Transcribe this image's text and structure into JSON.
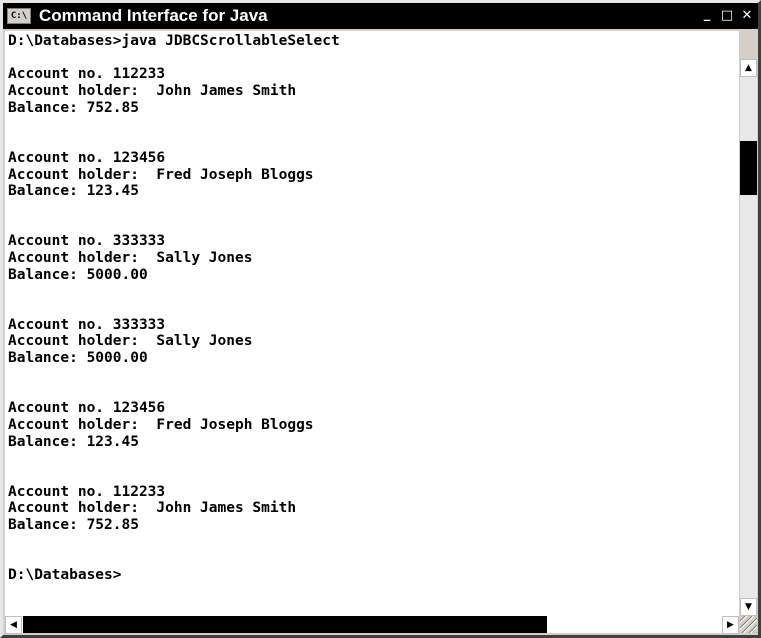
{
  "window": {
    "title": "Command Interface for Java",
    "icon_label": "C:\\",
    "icon": "console-icon",
    "buttons": {
      "minimize": "_",
      "maximize": "□",
      "close": "✕"
    }
  },
  "console": {
    "lines": [
      "D:\\Databases>java JDBCScrollableSelect",
      "",
      "Account no. 112233",
      "Account holder:  John James Smith",
      "Balance: 752.85",
      "",
      "",
      "Account no. 123456",
      "Account holder:  Fred Joseph Bloggs",
      "Balance: 123.45",
      "",
      "",
      "Account no. 333333",
      "Account holder:  Sally Jones",
      "Balance: 5000.00",
      "",
      "",
      "Account no. 333333",
      "Account holder:  Sally Jones",
      "Balance: 5000.00",
      "",
      "",
      "Account no. 123456",
      "Account holder:  Fred Joseph Bloggs",
      "Balance: 123.45",
      "",
      "",
      "Account no. 112233",
      "Account holder:  John James Smith",
      "Balance: 752.85",
      "",
      "",
      "D:\\Databases>"
    ]
  },
  "scrollbars": {
    "vertical": {
      "up_icon": "▲",
      "down_icon": "▼"
    },
    "horizontal": {
      "left_icon": "◀",
      "right_icon": "▶"
    }
  }
}
